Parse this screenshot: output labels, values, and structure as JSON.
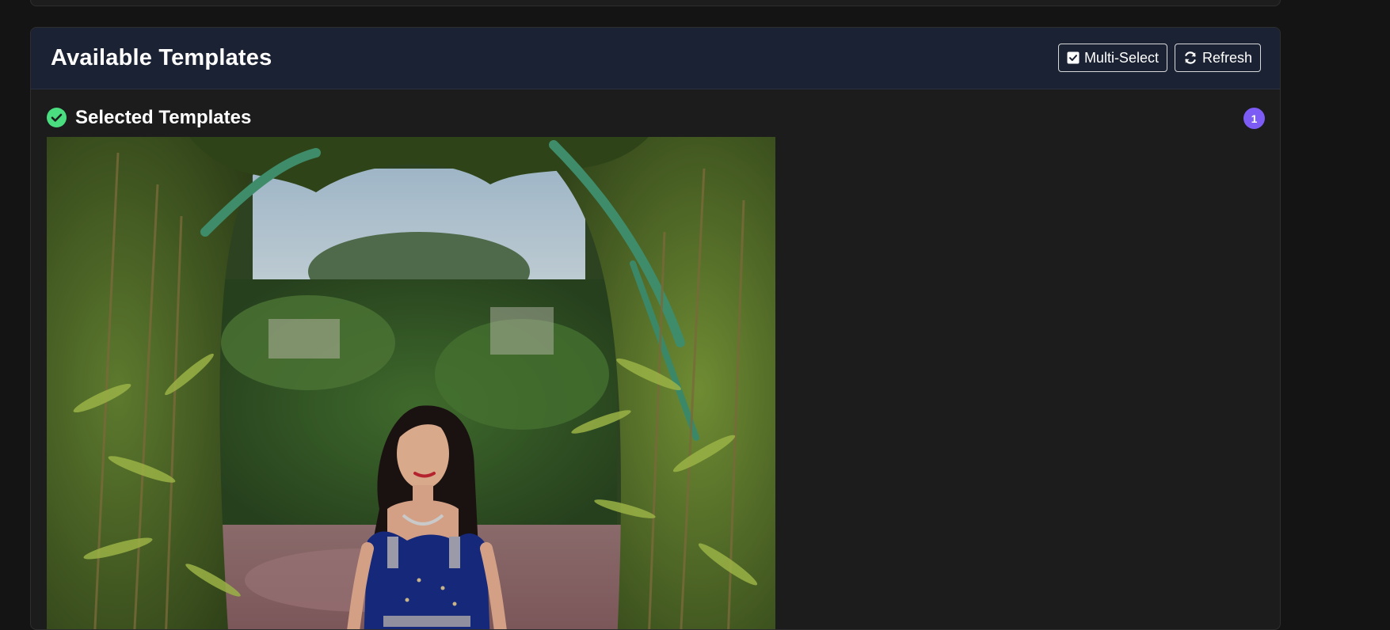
{
  "header": {
    "title": "Available Templates",
    "multi_select_label": "Multi-Select",
    "refresh_label": "Refresh"
  },
  "selected": {
    "title": "Selected Templates",
    "count": "1"
  },
  "colors": {
    "accent": "#7c5cf5",
    "success": "#4ade80",
    "header_bg": "#1b2233"
  },
  "icons": {
    "multi_select": "checkbox-checked-icon",
    "refresh": "refresh-icon",
    "selected": "check-circle-icon"
  }
}
